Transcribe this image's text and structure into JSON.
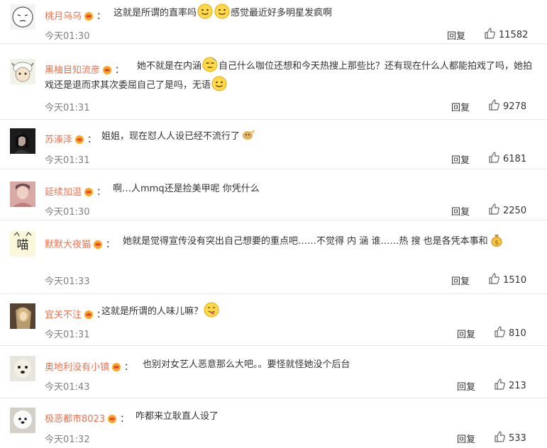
{
  "comments": [
    {
      "user": "桃月乌乌",
      "parts": [
        "这就是所谓的直率吗",
        {
          "emoji": "smile"
        },
        {
          "emoji": "smile"
        },
        "感觉最近好多明星发疯啊"
      ],
      "time": "今天01:30",
      "reply": "回复",
      "likes": "11582",
      "avatar": "cartoon-face"
    },
    {
      "user": "黑柚目知流彦",
      "parts": [
        "她不就是在内涵",
        {
          "emoji": "sigh"
        },
        "自己什么咖位还想和今天热搜上那些比？还有现在什么人都能拍戏了吗，她拍戏还是退而求其次委屈自己了是吗，无语",
        {
          "emoji": "smile"
        }
      ],
      "time": "今天01:31",
      "reply": "回复",
      "likes": "9278",
      "avatar": "cartoon-sheep"
    },
    {
      "user": "苏溱泽",
      "parts": [
        "姐姐，现在怼人人设已经不流行了",
        {
          "emoji": "doge-hand"
        }
      ],
      "time": "今天01:31",
      "reply": "回复",
      "likes": "6181",
      "avatar": "dark-portrait"
    },
    {
      "user": "延续加温",
      "parts": [
        "啊…人mmq还是捡美甲呢 你凭什么"
      ],
      "time": "今天01:30",
      "reply": "回复",
      "likes": "2250",
      "avatar": "photo-person"
    },
    {
      "user": "默默大夜猫",
      "parts": [
        "她就是觉得宣传没有突出自己想要的重点吧……不觉得 内 涵 谁……热 搜 也是各凭本事和",
        {
          "emoji": "moneybag"
        }
      ],
      "time": "今天01:33",
      "reply": "回复",
      "likes": "1510",
      "avatar": "meow-text"
    },
    {
      "user": "宜关不注",
      "parts": [
        "这就是所谓的人味儿嘛？",
        {
          "emoji": "tongue"
        }
      ],
      "time": "今天01:31",
      "reply": "回复",
      "likes": "810",
      "avatar": "photo-blonde"
    },
    {
      "user": "奥地利没有小镇",
      "parts": [
        "也别对女艺人恶意那么大吧。。要怪就怪她没个后台"
      ],
      "time": "今天01:43",
      "reply": "回复",
      "likes": "213",
      "avatar": "photo-dog"
    },
    {
      "user": "极恶都市8023",
      "parts": [
        "咋都来立耿直人设了"
      ],
      "time": "今天01:32",
      "reply": "回复",
      "likes": "533",
      "avatar": "photo-dog-white"
    }
  ],
  "colors": {
    "username": "#eb7350",
    "time": "#808080",
    "text": "#333333",
    "divider": "#e6e6e6"
  },
  "icons": {
    "crown": "vip-crown-icon",
    "like": "thumbs-up-icon"
  }
}
